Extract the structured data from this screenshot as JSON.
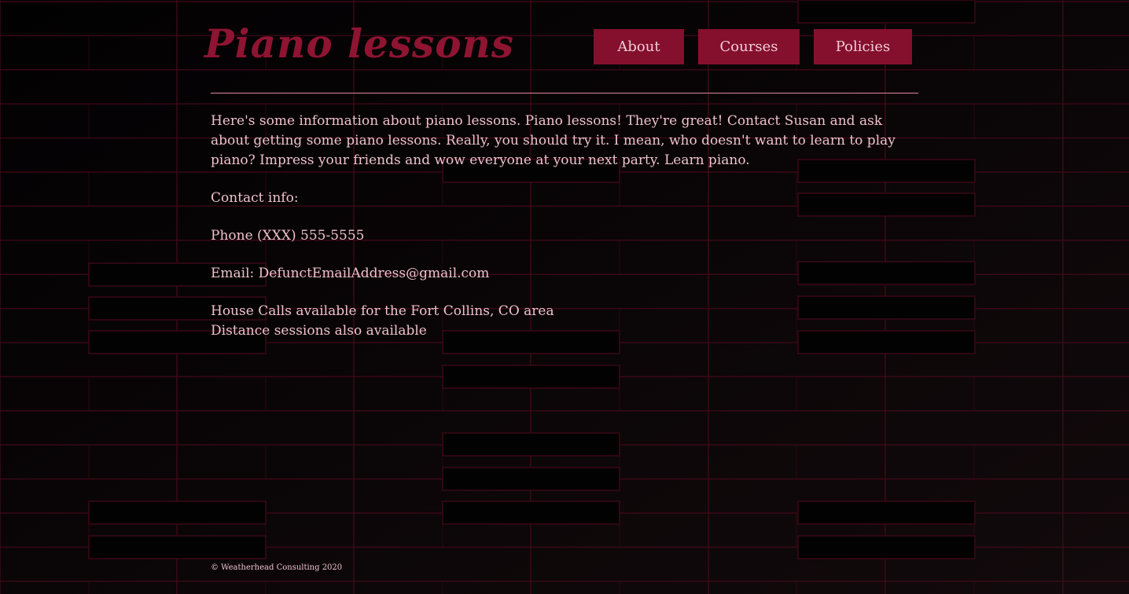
{
  "site": {
    "title": "Piano lessons",
    "brand_color": "#8e1432",
    "nav_color": "#84102e",
    "text_color": "#efc1cd"
  },
  "nav": {
    "items": [
      {
        "label": "About"
      },
      {
        "label": "Courses"
      },
      {
        "label": "Policies"
      }
    ]
  },
  "content": {
    "intro": "Here's some information about piano lessons. Piano lessons! They're great! Contact Susan and ask about getting some piano lessons. Really, you should try it. I mean, who doesn't want to learn to play piano? Impress your friends and wow everyone at your next party. Learn piano.",
    "contact_heading": "Contact info:",
    "phone": "Phone (XXX) 555-5555",
    "email": "Email: DefunctEmailAddress@gmail.com",
    "house_calls": "House Calls available for the Fort Collins, CO area",
    "distance": "Distance sessions also available"
  },
  "footer": {
    "copyright": "© Weatherhead Consulting 2020"
  }
}
